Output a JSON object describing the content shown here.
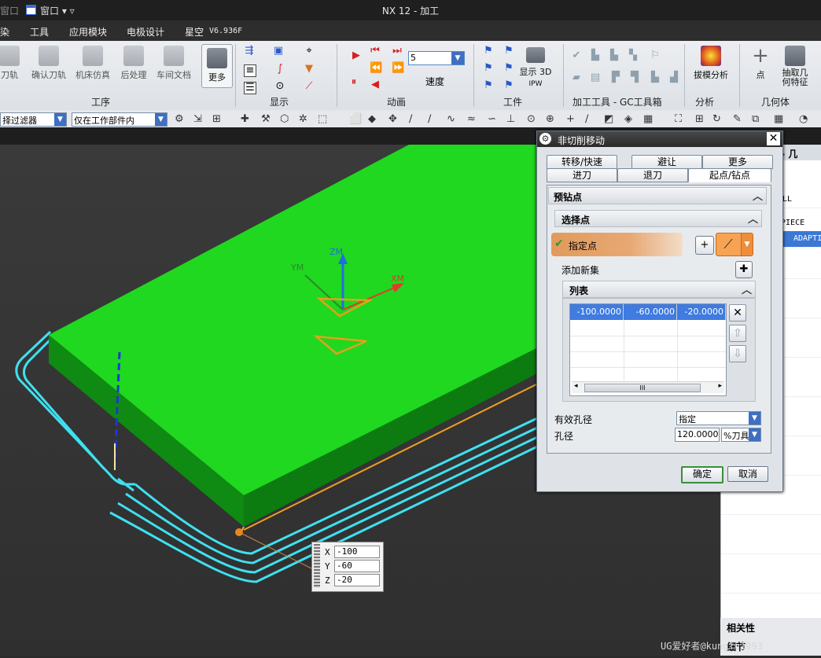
{
  "titlebar": {
    "app_title": "NX 12 - 加工",
    "menu_prefix": "窗口",
    "window_menu": "窗口 ▾ ▿"
  },
  "menubar": {
    "items": [
      "染",
      "工具",
      "应用模块",
      "电极设计",
      "星空"
    ],
    "version": "V6.936F"
  },
  "ribbon": {
    "buttons": [
      "刀轨",
      "确认刀轨",
      "机床仿真",
      "后处理",
      "车间文档",
      "更多",
      "显示 3D",
      "IPW",
      "拔模分析",
      "点",
      "抽取几何特征"
    ],
    "groups": {
      "process": "工序",
      "display": "显示",
      "animation": "动画",
      "workpiece": "工件",
      "tools": "加工工具 - GC工具箱",
      "analysis": "分析",
      "geometry": "几何体"
    },
    "speed_label": "速度",
    "speed_value": "5"
  },
  "filterbar": {
    "type_filter": "择过滤器",
    "scope_filter": "仅在工作部件内"
  },
  "navigator": {
    "header": "器 - 几",
    "rows": [
      "LL",
      "KPIECE",
      "ADAPTI"
    ],
    "bottom_labels": [
      "相关性",
      "细节"
    ]
  },
  "dialog": {
    "title": "非切削移动",
    "tabs_row1": [
      "转移/快速",
      "避让",
      "更多"
    ],
    "tabs_row2": [
      "进刀",
      "退刀",
      "起点/钻点"
    ],
    "section_predrill": "预钻点",
    "section_select_point": "选择点",
    "specify_point": "指定点",
    "add_new_set": "添加新集",
    "list_label": "列表",
    "list_rows": [
      [
        "-100.0000",
        "-60.0000",
        "-20.0000"
      ]
    ],
    "effective_hole_label": "有效孔径",
    "effective_hole_value": "指定",
    "hole_dia_label": "孔径",
    "hole_dia_value": "120.0000",
    "hole_dia_unit": "%刀具",
    "ok": "确定",
    "cancel": "取消"
  },
  "viewport": {
    "axis_labels": {
      "zm": "ZM",
      "ym": "YM",
      "xm": "XM"
    }
  },
  "coord_tooltip": {
    "x_label": "X",
    "x": "-100",
    "y_label": "Y",
    "y": "-60",
    "z_label": "Z",
    "z": "-20"
  },
  "watermark": "UG爱好者@kungfu1993",
  "colors": {
    "part_top": "#1fd81f",
    "part_side": "#0f8a12",
    "toolpath": "#3fe0f0",
    "edge": "#f0a020",
    "selection": "#3f7be0"
  }
}
